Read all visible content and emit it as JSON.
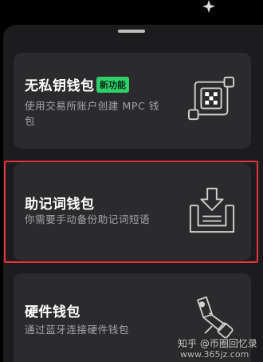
{
  "wallets": [
    {
      "title": "无私钥钱包",
      "badge": "新功能",
      "description": "使用交易所账户创建 MPC 钱包",
      "icon": "keyless-wallet-icon"
    },
    {
      "title": "助记词钱包",
      "description": "你需要手动备份助记词短语",
      "icon": "seed-phrase-download-icon"
    },
    {
      "title": "硬件钱包",
      "description": "通过蓝牙连接硬件钱包",
      "icon": "usb-hardware-key-icon"
    }
  ],
  "watermark": {
    "line1": "知乎 @币圈回忆录",
    "line2": "www.365jz.com"
  },
  "colors": {
    "badge": "#2fd06a",
    "highlight": "#e2343a",
    "card": "#2b2b2d",
    "sheet": "#1c1c1e"
  }
}
